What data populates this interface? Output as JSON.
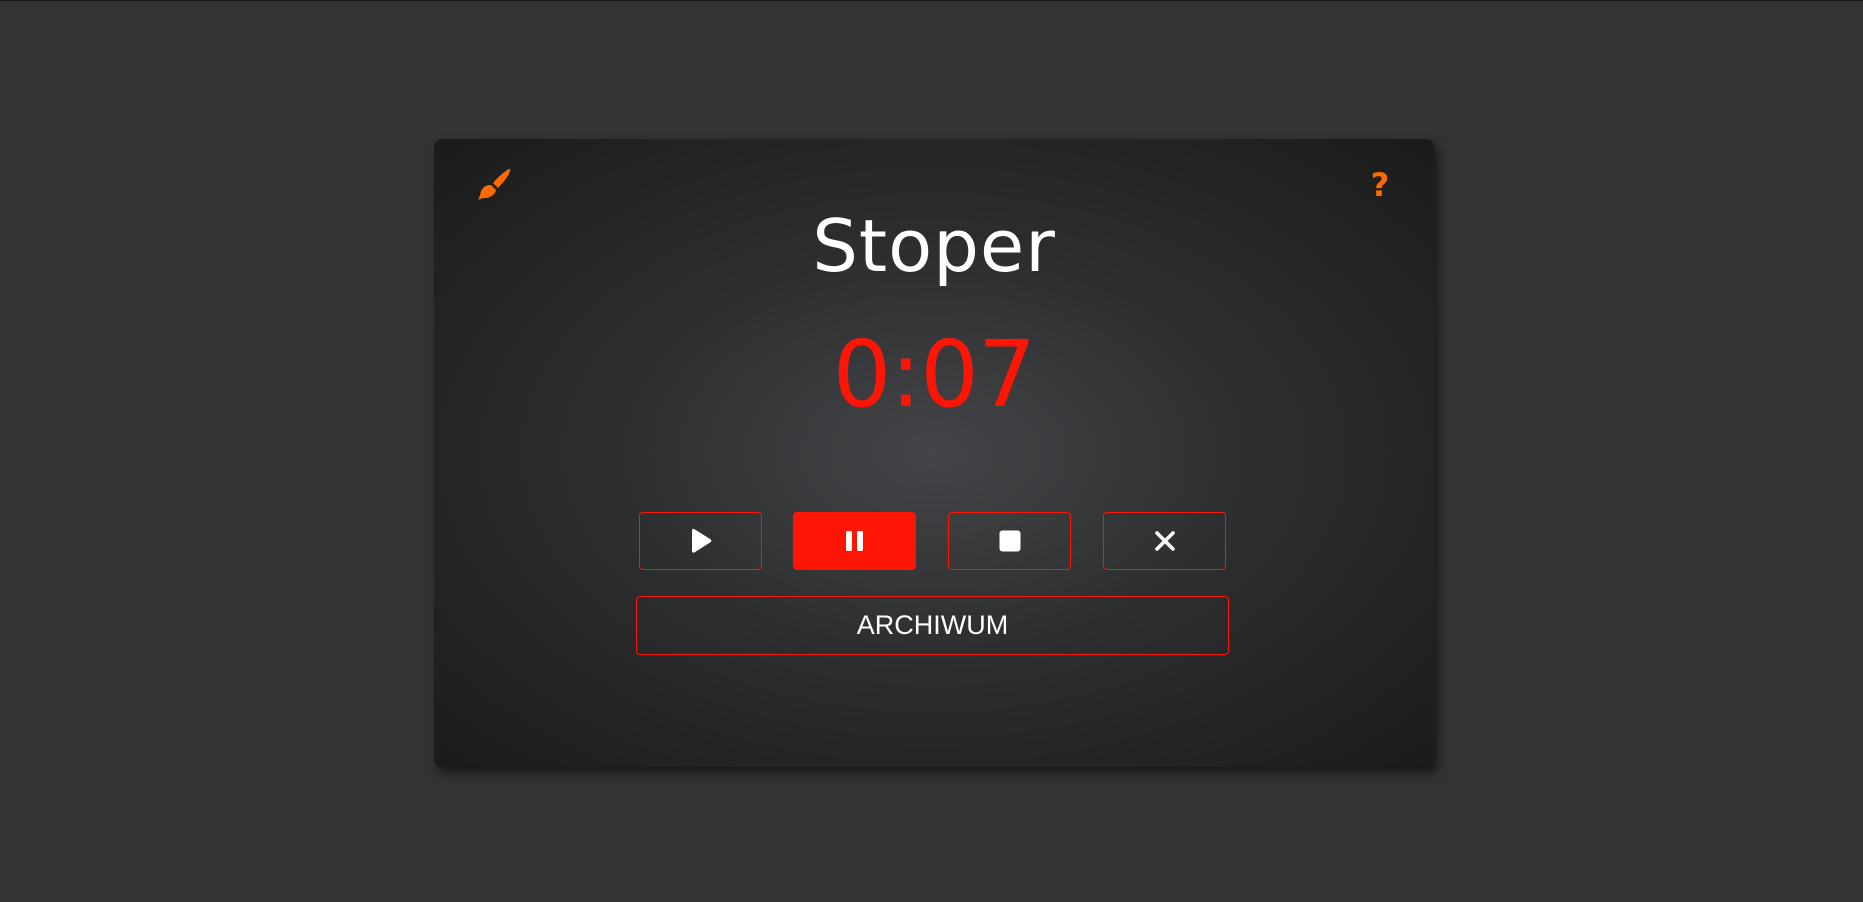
{
  "app": {
    "title": "Stoper",
    "time": "0:07"
  },
  "header": {
    "theme_icon": "paintbrush-icon",
    "help_icon": "question-icon",
    "help_glyph": "?"
  },
  "controls": {
    "play_icon": "play-icon",
    "pause_icon": "pause-icon",
    "stop_icon": "stop-icon",
    "reset_icon": "close-icon",
    "active": "pause"
  },
  "archive": {
    "label": "ARCHIWUM"
  },
  "colors": {
    "background": "#333333",
    "accent": "#ff1505",
    "icon_accent": "#ff6a00",
    "text": "#ffffff"
  }
}
